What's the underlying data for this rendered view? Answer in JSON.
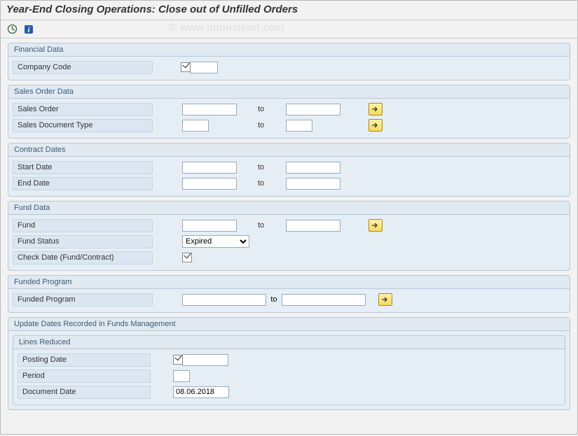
{
  "title": "Year-End Closing Operations: Close out of Unfilled Orders",
  "watermark": "© www.tutorialkart.com",
  "panels": {
    "financial": {
      "title": "Financial Data",
      "company_code_label": "Company Code",
      "company_code_value": ""
    },
    "sales": {
      "title": "Sales Order Data",
      "sales_order_label": "Sales Order",
      "sales_order_from": "",
      "sales_order_to": "",
      "sales_doc_type_label": "Sales Document Type",
      "sales_doc_type_from": "",
      "sales_doc_type_to": ""
    },
    "contract": {
      "title": "Contract Dates",
      "start_date_label": "Start Date",
      "start_from": "",
      "start_to": "",
      "end_date_label": "End Date",
      "end_from": "",
      "end_to": ""
    },
    "fund": {
      "title": "Fund Data",
      "fund_label": "Fund",
      "fund_from": "",
      "fund_to": "",
      "fund_status_label": "Fund Status",
      "fund_status_value": "Expired",
      "check_date_label": "Check Date (Fund/Contract)"
    },
    "funded_prog": {
      "title": "Funded Program",
      "label": "Funded Program",
      "from": "",
      "to": ""
    },
    "update": {
      "title": "Update Dates Recorded in Funds Management",
      "sub_title": "Lines Reduced",
      "posting_date_label": "Posting Date",
      "posting_date_value": "",
      "period_label": "Period",
      "period_value": "",
      "document_date_label": "Document Date",
      "document_date_value": "08.06.2018"
    }
  },
  "common": {
    "to": "to"
  }
}
